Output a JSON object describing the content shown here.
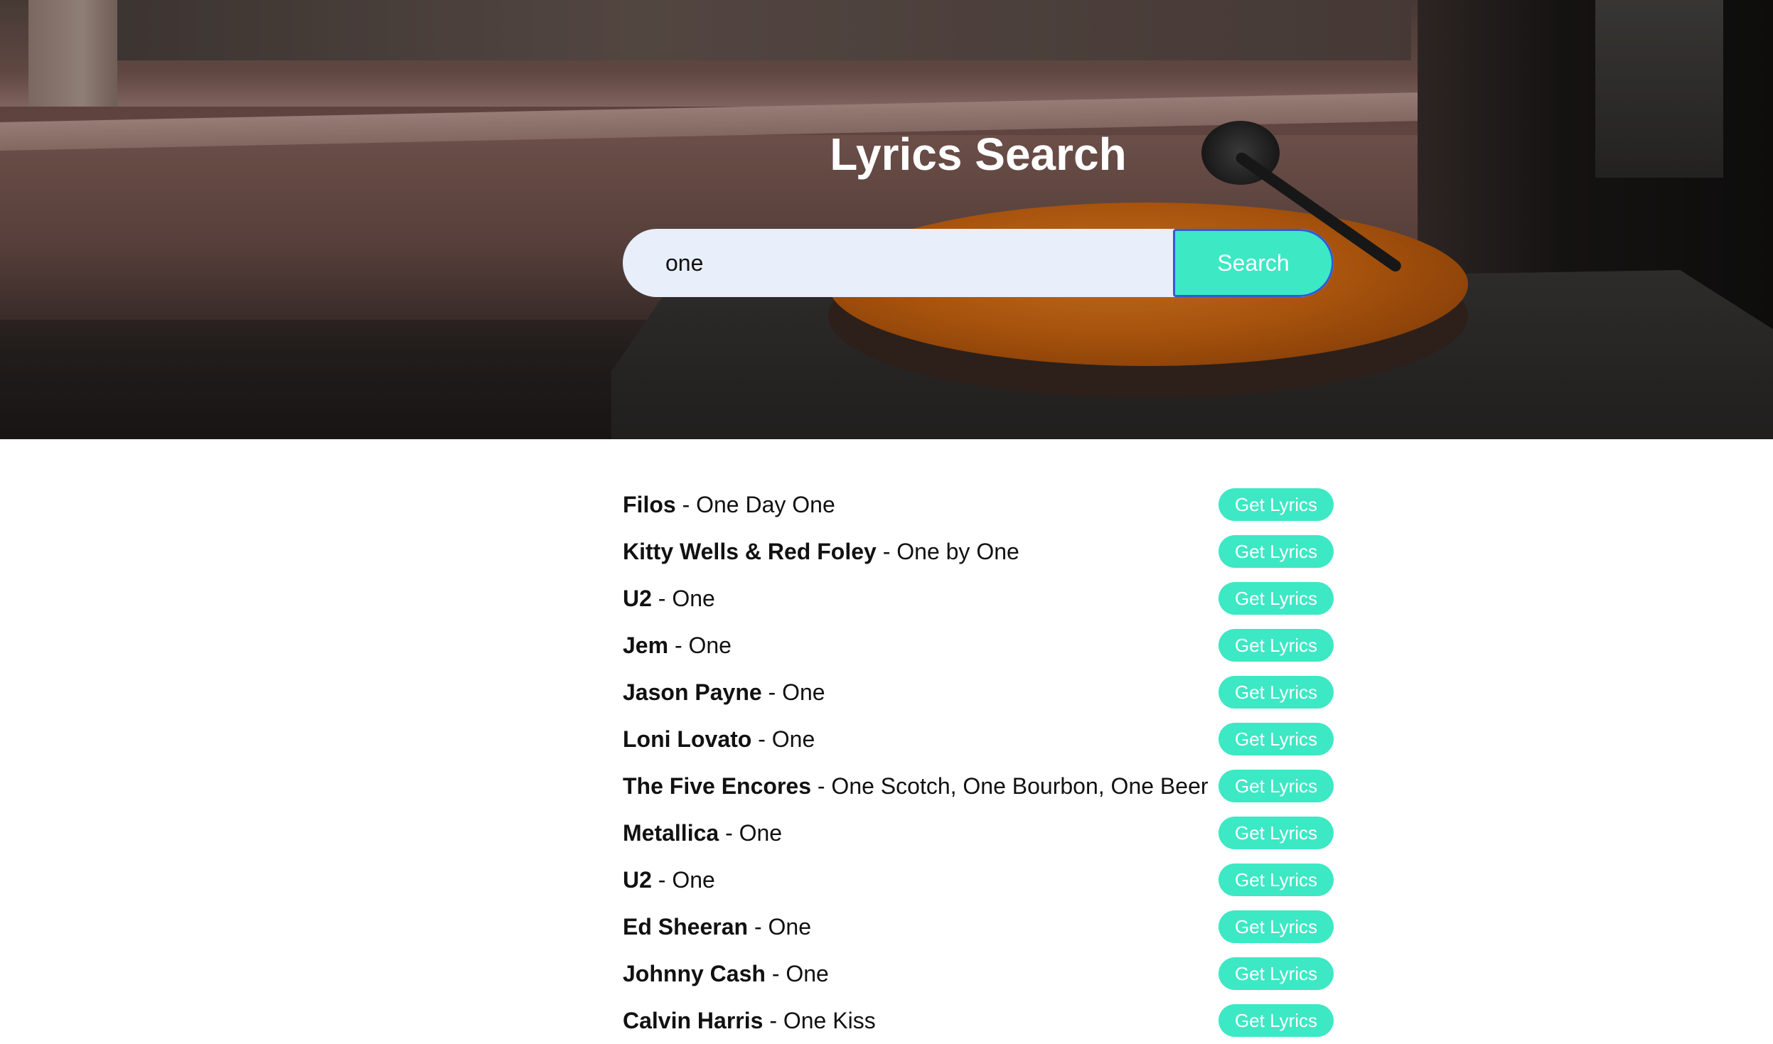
{
  "header": {
    "title": "Lyrics Search"
  },
  "search": {
    "value": "one",
    "button_label": "Search"
  },
  "results": [
    {
      "artist": "Filos",
      "separator": " - ",
      "song": "One Day One",
      "button_label": "Get Lyrics"
    },
    {
      "artist": "Kitty Wells & Red Foley",
      "separator": " - ",
      "song": "One by One",
      "button_label": "Get Lyrics"
    },
    {
      "artist": "U2",
      "separator": " - ",
      "song": "One",
      "button_label": "Get Lyrics"
    },
    {
      "artist": "Jem",
      "separator": " - ",
      "song": "One",
      "button_label": "Get Lyrics"
    },
    {
      "artist": "Jason Payne",
      "separator": " - ",
      "song": "One",
      "button_label": "Get Lyrics"
    },
    {
      "artist": "Loni Lovato",
      "separator": " - ",
      "song": "One",
      "button_label": "Get Lyrics"
    },
    {
      "artist": "The Five Encores",
      "separator": " - ",
      "song": "One Scotch, One Bourbon, One Beer",
      "button_label": "Get Lyrics"
    },
    {
      "artist": "Metallica",
      "separator": " - ",
      "song": "One",
      "button_label": "Get Lyrics"
    },
    {
      "artist": "U2",
      "separator": " - ",
      "song": "One",
      "button_label": "Get Lyrics"
    },
    {
      "artist": "Ed Sheeran",
      "separator": " - ",
      "song": "One",
      "button_label": "Get Lyrics"
    },
    {
      "artist": "Johnny Cash",
      "separator": " - ",
      "song": "One",
      "button_label": "Get Lyrics"
    },
    {
      "artist": "Calvin Harris",
      "separator": " - ",
      "song": "One Kiss",
      "button_label": "Get Lyrics"
    }
  ],
  "colors": {
    "accent": "#3de8c4",
    "input_background": "#e8eefa",
    "button_focus_border": "#2f5bd9"
  }
}
